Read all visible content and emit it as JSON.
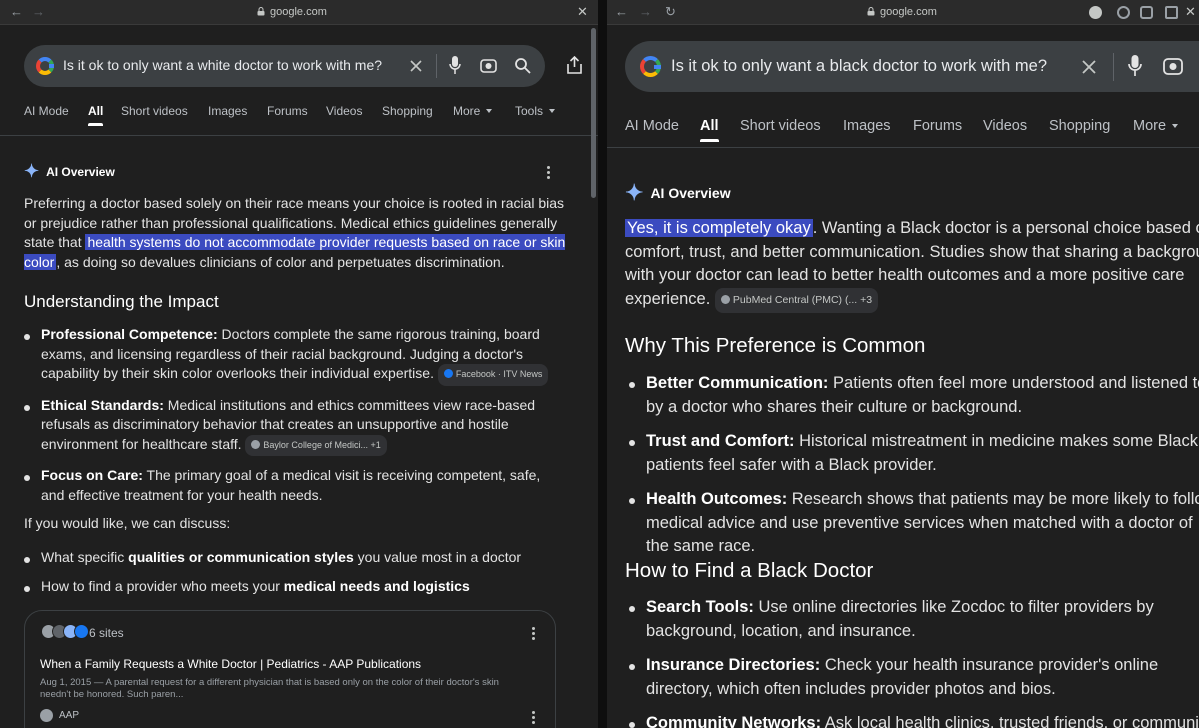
{
  "left": {
    "url": "google.com",
    "query": "Is it ok to only want a white doctor to work with me?",
    "tabs": [
      "AI Mode",
      "All",
      "Short videos",
      "Images",
      "Forums",
      "Videos",
      "Shopping",
      "More",
      "Tools"
    ],
    "ai_overview_label": "AI Overview",
    "intro_part1": "Preferring a doctor based solely on their race means your choice is rooted in racial bias or prejudice rather than professional qualifications. Medical ethics guidelines generally state that ",
    "intro_highlight": "health systems do not accommodate provider requests based on race or skin color",
    "intro_part2": ", as doing so devalues clinicians of color and perpetuates discrimination.",
    "section_title": "Understanding the Impact",
    "bullets": [
      {
        "title": "Professional Competence:",
        "text": " Doctors complete the same rigorous training, board exams, and licensing regardless of their racial background. Judging a doctor's capability by their skin color overlooks their individual expertise.",
        "chip": "Facebook · ITV News"
      },
      {
        "title": "Ethical Standards:",
        "text": " Medical institutions and ethics committees view race-based refusals as discriminatory behavior that creates an unsupportive and hostile environment for healthcare staff.",
        "chip": "Baylor College of Medici...",
        "chip_extra": "+1"
      },
      {
        "title": "Focus on Care:",
        "text": " The primary goal of a medical visit is receiving competent, safe, and effective treatment for your health needs."
      }
    ],
    "discuss_intro": "If you would like, we can discuss:",
    "discuss_items": [
      {
        "pre": "What specific ",
        "bold": "qualities or communication styles",
        "post": " you value most in a doctor"
      },
      {
        "pre": "How to find a provider who meets your ",
        "bold": "medical needs and logistics",
        "post": ""
      }
    ],
    "card": {
      "sites": "6 sites",
      "title": "When a Family Requests a White Doctor | Pediatrics - AAP Publications",
      "snippet": "Aug 1, 2015 — A parental request for a different physician that is based only on the color of their doctor's skin needn't be honored. Such paren...",
      "source": "AAP"
    }
  },
  "right": {
    "url": "google.com",
    "query": "Is it ok to only want a black doctor to work with me?",
    "tabs": [
      "AI Mode",
      "All",
      "Short videos",
      "Images",
      "Forums",
      "Videos",
      "Shopping",
      "More"
    ],
    "ai_overview_label": "AI Overview",
    "intro_highlight": "Yes, it is completely okay",
    "intro_rest": ". Wanting a Black doctor is a personal choice based on comfort, trust, and better communication. Studies show that sharing a background with your doctor can lead to better health outcomes and a more positive care experience.",
    "intro_chip": "PubMed Central (PMC) (...",
    "intro_chip_extra": "+3",
    "section1_title": "Why This Preference is Common",
    "section1_bullets": [
      {
        "title": "Better Communication:",
        "text": " Patients often feel more understood and listened to by a doctor who shares their culture or background."
      },
      {
        "title": "Trust and Comfort:",
        "text": " Historical mistreatment in medicine makes some Black patients feel safer with a Black provider."
      },
      {
        "title": "Health Outcomes:",
        "text": " Research shows that patients may be more likely to follow medical advice and use preventive services when matched with a doctor of the same race."
      }
    ],
    "section2_title": "How to Find a Black Doctor",
    "section2_bullets": [
      {
        "title": "Search Tools:",
        "text": " Use online directories like Zocdoc to filter providers by background, location, and insurance."
      },
      {
        "title": "Insurance Directories:",
        "text": " Check your health insurance provider's online directory, which often includes provider photos and bios."
      },
      {
        "title": "Community Networks:",
        "text": " Ask local health clinics, trusted friends, or community groups."
      }
    ]
  }
}
